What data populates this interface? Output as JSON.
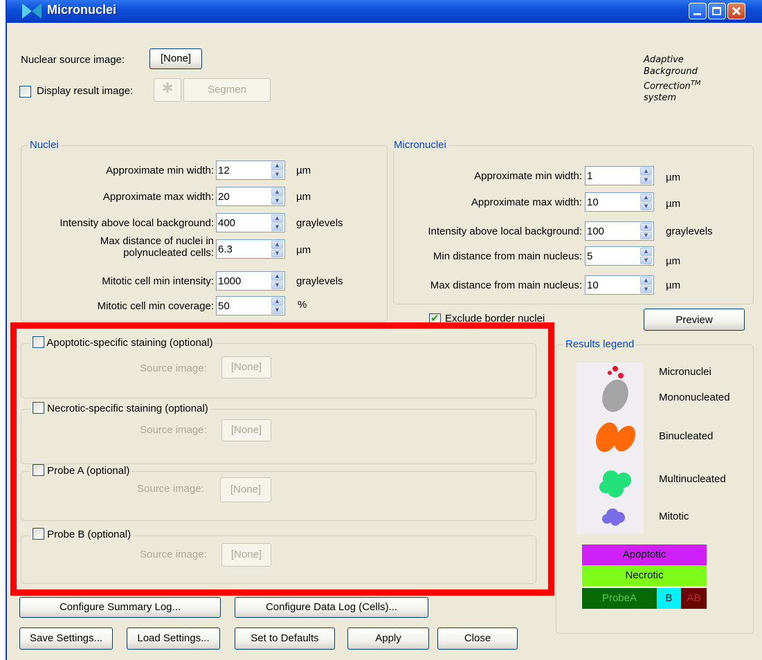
{
  "window": {
    "title": "Micronuclei"
  },
  "top": {
    "nuclear_source_label": "Nuclear source image:",
    "nuclear_source_button": "[None]",
    "display_result_label": "Display result image:",
    "segmen_button": "Segmen",
    "abc_lines": [
      "Adaptive",
      "Background",
      "Correction",
      "system"
    ],
    "abc_tm": "TM"
  },
  "nuclei": {
    "title": "Nuclei",
    "rows": [
      {
        "label": "Approximate min width:",
        "value": "12",
        "unit": "µm"
      },
      {
        "label": "Approximate max width:",
        "value": "20",
        "unit": "µm"
      },
      {
        "label": "Intensity above local background:",
        "value": "400",
        "unit": "graylevels"
      },
      {
        "label_line1": "Max distance of nuclei in",
        "label_line2": "polynucleated cells:",
        "value": "6.3",
        "unit": "µm"
      },
      {
        "label": "Mitotic cell min intensity:",
        "value": "1000",
        "unit": "graylevels"
      },
      {
        "label": "Mitotic cell min coverage:",
        "value": "50",
        "unit": "%"
      }
    ]
  },
  "micronuclei": {
    "title": "Micronuclei",
    "rows": [
      {
        "label": "Approximate min width:",
        "value": "1",
        "unit": "µm"
      },
      {
        "label": "Approximate max width:",
        "value": "10",
        "unit": "µm"
      },
      {
        "label": "Intensity above local background:",
        "value": "100",
        "unit": "graylevels"
      },
      {
        "label": "Min distance from main nucleus:",
        "value": "5",
        "unit": "µm"
      },
      {
        "label": "Max distance from main nucleus:",
        "value": "10",
        "unit": "µm"
      }
    ],
    "exclude_border_label": "Exclude border nuclei",
    "exclude_border_checked": true,
    "preview_button": "Preview"
  },
  "optional": {
    "source_label": "Source image:",
    "none_button": "[None]",
    "groups": [
      {
        "label": "Apoptotic-specific staining (optional)"
      },
      {
        "label": "Necrotic-specific staining (optional)"
      },
      {
        "label": "Probe A (optional)"
      },
      {
        "label": "Probe B (optional)"
      }
    ]
  },
  "legend": {
    "title": "Results legend",
    "items": [
      "Micronuclei",
      "Mononucleated",
      "Binucleated",
      "Multinucleated",
      "Mitotic"
    ],
    "colors": {
      "micronuclei": "#e8102a",
      "mononucleated": "#a4a4a4",
      "binucleated": "#ff6a08",
      "multinucleated": "#22e07a",
      "mitotic": "#7a6ce6"
    },
    "bars": {
      "apoptotic": {
        "label": "Apoptotic",
        "color": "#d020f8"
      },
      "necrotic": {
        "label": "Necrotic",
        "color": "#7cfc18"
      },
      "probeA": {
        "label": "ProbeA",
        "color": "#066b06"
      },
      "b": {
        "label": "B",
        "color": "#06f0f8"
      },
      "ab": {
        "label": "AB",
        "color": "#6b0606"
      }
    }
  },
  "bottom": {
    "configure_summary": "Configure Summary Log...",
    "configure_data": "Configure Data Log (Cells)...",
    "save": "Save Settings...",
    "load": "Load Settings...",
    "defaults": "Set to Defaults",
    "apply": "Apply",
    "close": "Close"
  },
  "highlight_color": "#ff0000"
}
